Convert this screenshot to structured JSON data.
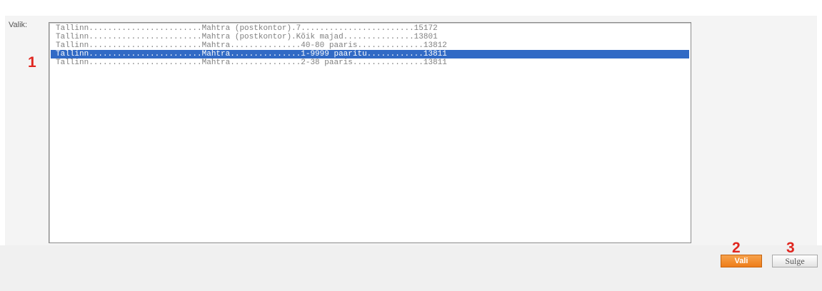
{
  "form": {
    "label": "Valik:"
  },
  "list": {
    "selected_index": 3,
    "items": [
      "Tallinn........................Mahtra (postkontor).7........................15172",
      "Tallinn........................Mahtra (postkontor).Kõik majad...............13801",
      "Tallinn........................Mahtra...............40-80 paaris..............13812",
      "Tallinn........................Mahtra...............1-9999 paaritu............13811",
      "Tallinn........................Mahtra...............2-38 paaris...............13811"
    ]
  },
  "annotations": {
    "one": "1",
    "two": "2",
    "three": "3"
  },
  "buttons": {
    "select": "Vali",
    "close": "Sulge"
  },
  "colors": {
    "selection": "#316ac5",
    "annotation": "#e0261f",
    "primary_button": "#ee7d1a"
  }
}
